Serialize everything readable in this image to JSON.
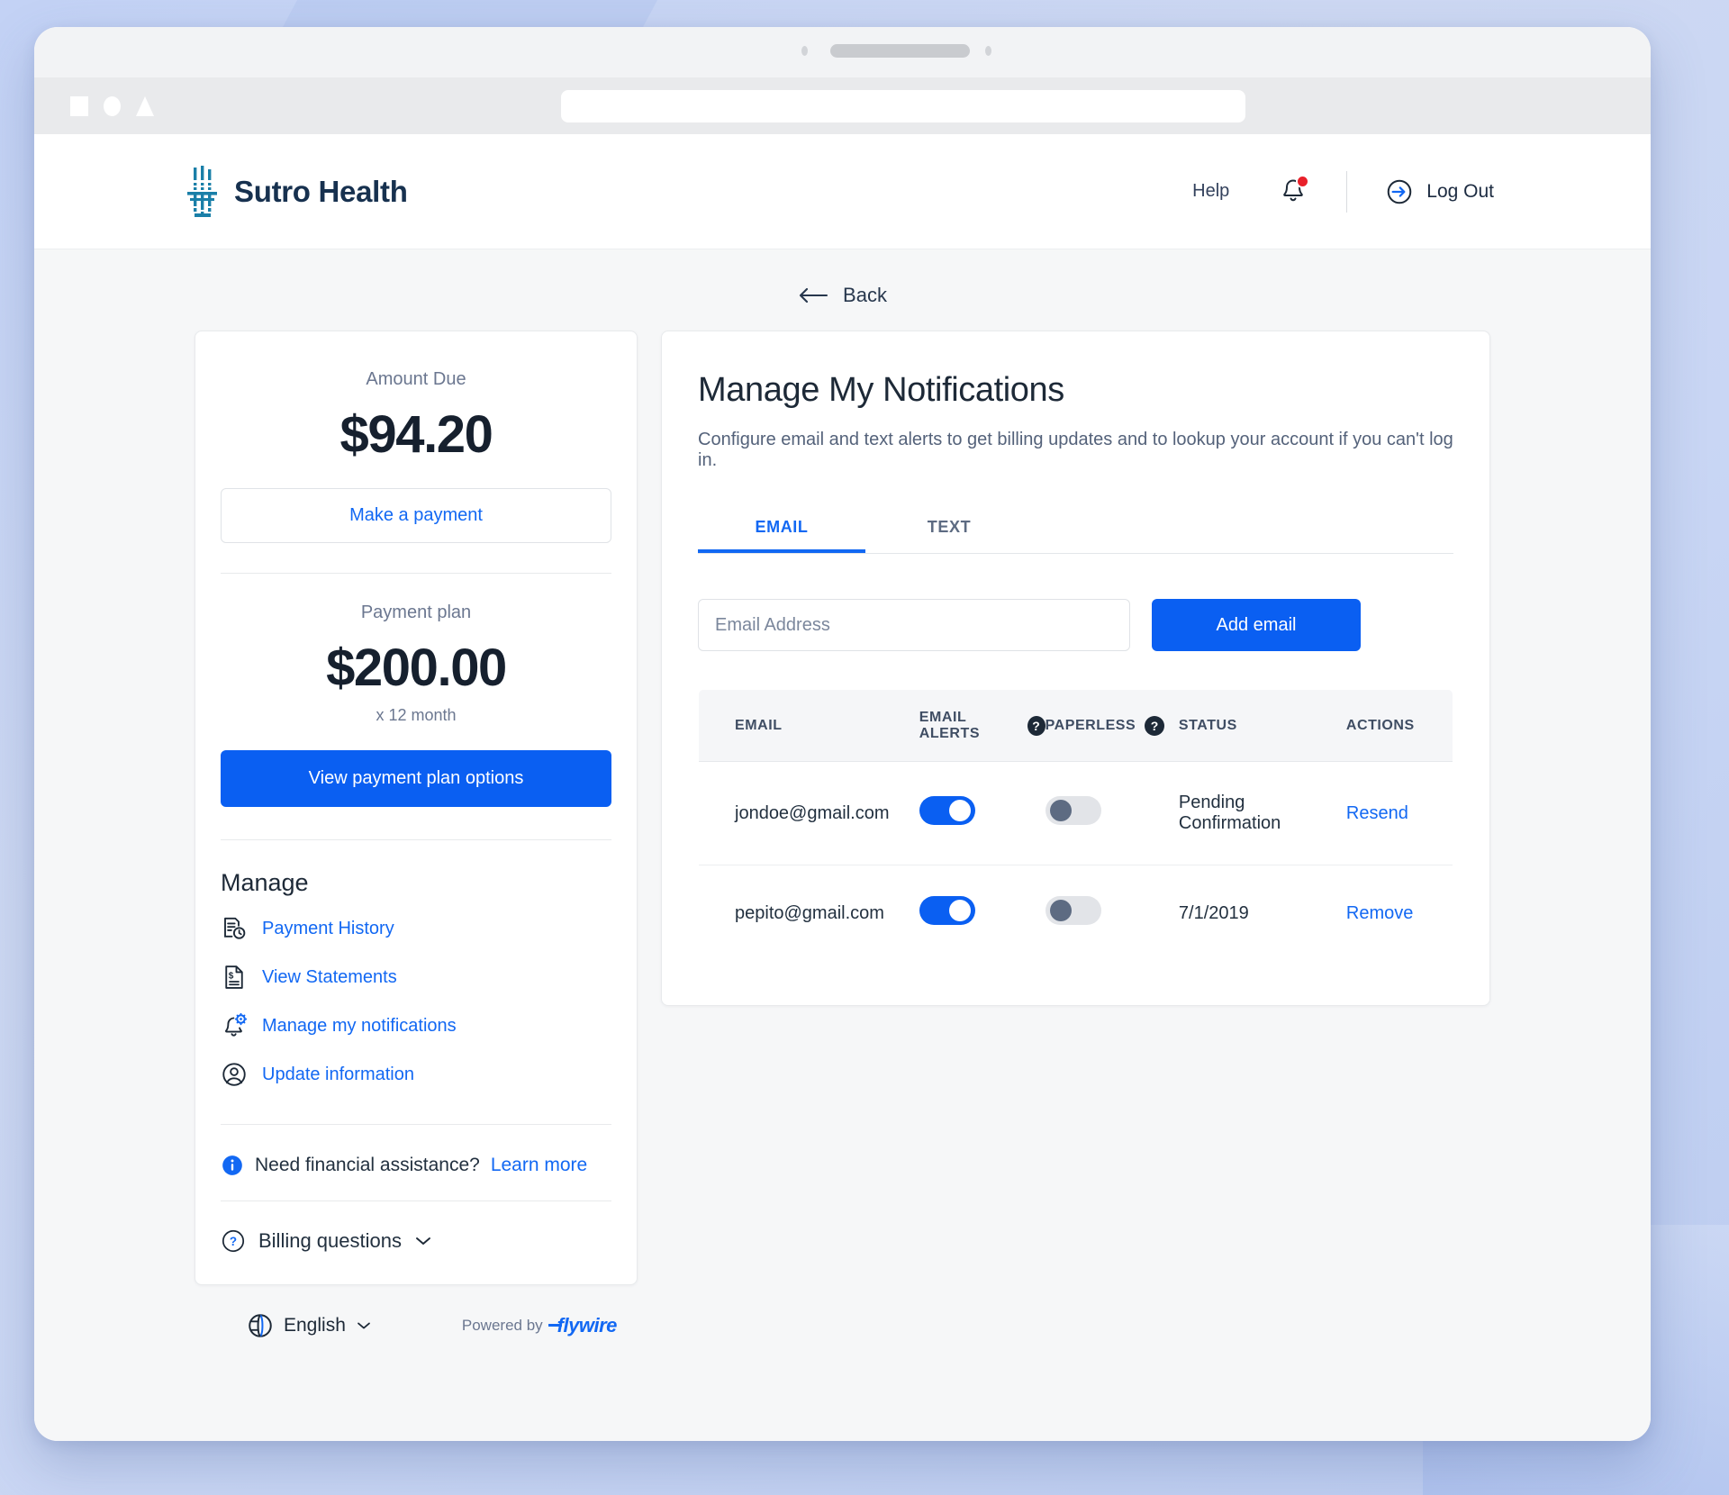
{
  "browser": {
    "nav_icons": [
      "square-shape",
      "circle-shape",
      "triangle-shape"
    ],
    "address_value": ""
  },
  "header": {
    "brand": "Sutro Health",
    "help_label": "Help",
    "logout_label": "Log Out"
  },
  "back": {
    "label": "Back"
  },
  "sidebar": {
    "amount_due_label": "Amount Due",
    "amount_due_value": "$94.20",
    "make_payment_label": "Make a payment",
    "payment_plan_label": "Payment plan",
    "payment_plan_value": "$200.00",
    "payment_plan_term": "x 12 month",
    "view_plan_label": "View payment plan options",
    "manage_title": "Manage",
    "items": [
      {
        "label": "Payment History",
        "icon": "document-clock-icon"
      },
      {
        "label": "View Statements",
        "icon": "document-dollar-icon"
      },
      {
        "label": "Manage my notifications",
        "icon": "bell-gear-icon"
      },
      {
        "label": "Update information",
        "icon": "user-circle-icon"
      }
    ],
    "assistance_text": "Need financial assistance?",
    "assistance_link": "Learn more",
    "billing_questions": "Billing questions"
  },
  "footer": {
    "language": "English",
    "powered_by": "Powered by",
    "provider": "flywire"
  },
  "main": {
    "title": "Manage My Notifications",
    "subtitle": "Configure email and text alerts to get billing updates and to lookup your account if you can't log in.",
    "tabs": [
      {
        "label": "EMAIL",
        "active": true
      },
      {
        "label": "TEXT",
        "active": false
      }
    ],
    "email_input_placeholder": "Email Address",
    "email_input_value": "",
    "add_email_label": "Add email",
    "table": {
      "columns": [
        "EMAIL",
        "EMAIL ALERTS",
        "PAPERLESS",
        "STATUS",
        "ACTIONS"
      ],
      "rows": [
        {
          "email": "jondoe@gmail.com",
          "email_alerts": "on",
          "paperless": "off",
          "status": "Pending Confirmation",
          "action": "Resend"
        },
        {
          "email": "pepito@gmail.com",
          "email_alerts": "on",
          "paperless": "off",
          "status": "7/1/2019",
          "action": "Remove"
        }
      ]
    }
  },
  "colors": {
    "accent_blue": "#0a5ff2",
    "link_blue": "#1268f3",
    "text_dark": "#1d2937",
    "brand_navy": "#17314f",
    "notification_red": "#e8202a"
  }
}
